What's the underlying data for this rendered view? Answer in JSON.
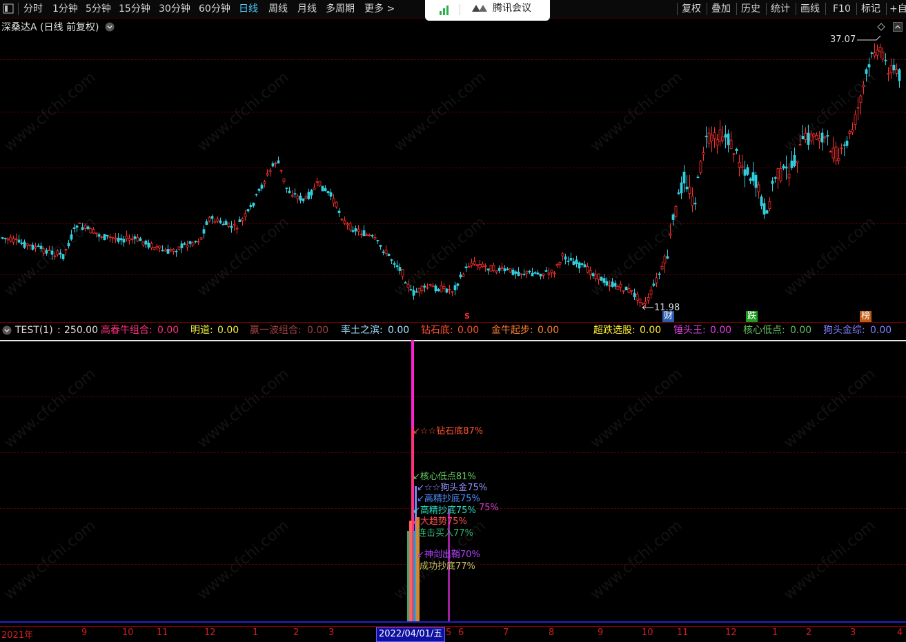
{
  "toolbar": {
    "periods": [
      "分时",
      "1分钟",
      "5分钟",
      "15分钟",
      "30分钟",
      "60分钟",
      "日线",
      "周线",
      "月线",
      "多周期",
      "更多 >"
    ],
    "active_period": "日线",
    "right_buttons": [
      "复权",
      "叠加",
      "历史",
      "统计",
      "画线",
      "F10",
      "标记",
      "+自"
    ]
  },
  "meeting_popup": {
    "label": "腾讯会议"
  },
  "chart_title": "深桑达A (日线 前复权)",
  "price_annotations": {
    "high": "37.07",
    "low": "11.98"
  },
  "signal_markers": [
    {
      "text": "S",
      "color": "#ff3030"
    },
    {
      "text": "财",
      "color": "#3a7bd5"
    },
    {
      "text": "跌",
      "color": "#20c020"
    },
    {
      "text": "榜",
      "color": "#d06010"
    }
  ],
  "indicator_header": {
    "name": "TEST(1)",
    "value": "250.00",
    "items": [
      {
        "label": "高春牛组合:",
        "value": "0.00",
        "color": "#ff3080"
      },
      {
        "label": "明道:",
        "value": "0.00",
        "color": "#f0f040"
      },
      {
        "label": "赢一波组合:",
        "value": "0.00",
        "color": "#a04040"
      },
      {
        "label": "率土之滨:",
        "value": "0.00",
        "color": "#a0e0ff"
      },
      {
        "label": "钻石底:",
        "value": "0.00",
        "color": "#ff5030"
      },
      {
        "label": "金牛起步:",
        "value": "0.00",
        "color": "#ff8030"
      },
      {
        "label": "超跌选股:",
        "value": "0.00",
        "color": "#ffee30"
      },
      {
        "label": "锤头王:",
        "value": "0.00",
        "color": "#e040e0"
      },
      {
        "label": "核心低点:",
        "value": "0.00",
        "color": "#60c060"
      },
      {
        "label": "狗头金综:",
        "value": "0.00",
        "color": "#8080ff"
      }
    ]
  },
  "bar_labels": [
    {
      "text": "☆☆钻石底87%",
      "color": "#ff5030"
    },
    {
      "text": "核心低点81%",
      "color": "#60d060"
    },
    {
      "text": "☆☆狗头金75%",
      "color": "#9090ff"
    },
    {
      "text": "高精抄底75%",
      "color": "#5090ff"
    },
    {
      "text": "高精抄底75%",
      "color": "#20e0c0"
    },
    {
      "text": "75%",
      "color": "#d040d0"
    },
    {
      "text": "大趋势75%",
      "color": "#ff5050"
    },
    {
      "text": "连击买入77%",
      "color": "#30b070"
    },
    {
      "text": "神剑出鞘70%",
      "color": "#b040ff"
    },
    {
      "text": "成功抄底77%",
      "color": "#c0c060"
    }
  ],
  "time_axis": {
    "labels": [
      "2021年",
      "9",
      "10",
      "11",
      "12",
      "1",
      "2",
      "3",
      "2022/04/01/五",
      "5",
      "6",
      "7",
      "8",
      "9",
      "10",
      "11",
      "12",
      "1",
      "2",
      "3",
      "4"
    ]
  },
  "watermark": "www.cfchi.com",
  "colors": {
    "up": "#ff3030",
    "down": "#30d0e0",
    "grid": "#5a0000",
    "axis": "#c00000",
    "bar_main": "#ff20d0"
  }
}
